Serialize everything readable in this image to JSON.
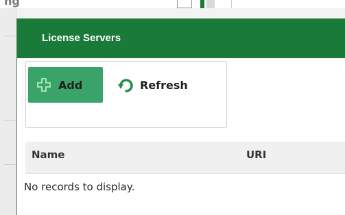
{
  "background": {
    "partial_text": "ng"
  },
  "dialog": {
    "title": "License Servers",
    "toolbar": {
      "add_label": "Add",
      "refresh_label": "Refresh",
      "add_icon": "plus-icon",
      "refresh_icon": "refresh-icon"
    },
    "table": {
      "columns": [
        "Name",
        "URI"
      ],
      "empty_message": "No records to display."
    }
  },
  "colors": {
    "header_green": "#1a7a3a",
    "add_button_green": "#3aa36a",
    "table_header_bg": "#f0f0f0"
  }
}
